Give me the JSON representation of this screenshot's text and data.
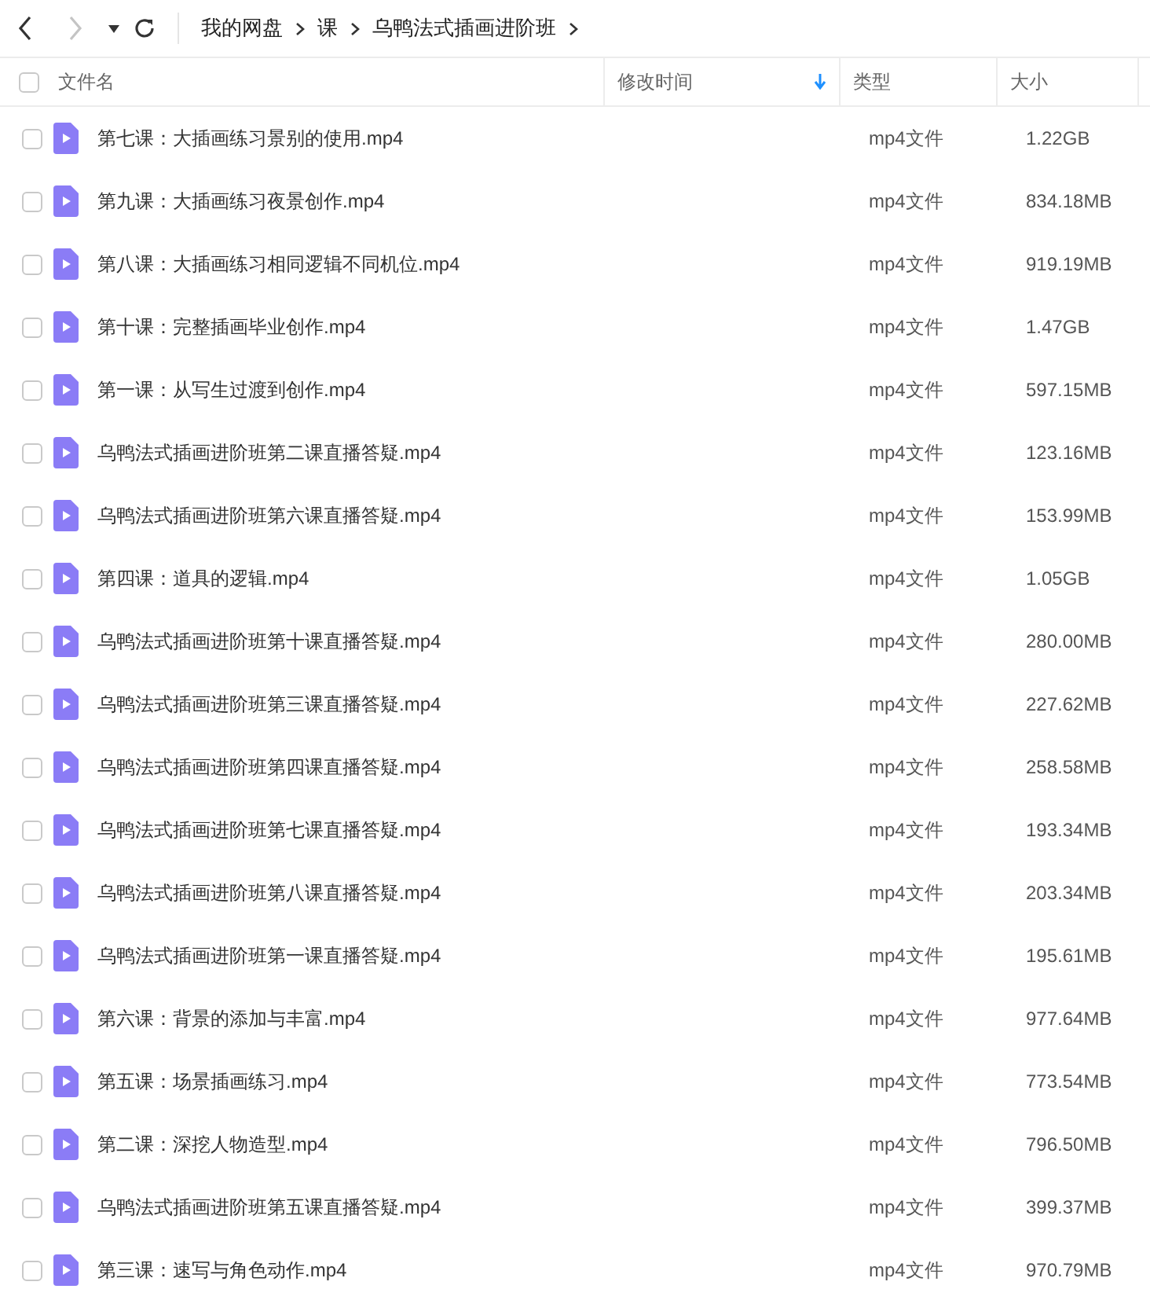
{
  "toolbar": {
    "back": {
      "disabled": false
    },
    "forward": {
      "disabled": true
    }
  },
  "breadcrumbs": [
    "我的网盘",
    "课",
    "乌鸭法式插画进阶班"
  ],
  "columns": [
    {
      "label": "文件名",
      "sorted": false
    },
    {
      "label": "修改时间",
      "sorted": true
    },
    {
      "label": "类型",
      "sorted": false
    },
    {
      "label": "大小",
      "sorted": false
    }
  ],
  "header_checkbox": {
    "checked": false
  },
  "files": [
    {
      "name": "第七课：大插画练习景别的使用.mp4",
      "type": "mp4文件",
      "size": "1.22GB",
      "checked": false
    },
    {
      "name": "第九课：大插画练习夜景创作.mp4",
      "type": "mp4文件",
      "size": "834.18MB",
      "checked": false
    },
    {
      "name": "第八课：大插画练习相同逻辑不同机位.mp4",
      "type": "mp4文件",
      "size": "919.19MB",
      "checked": false
    },
    {
      "name": "第十课：完整插画毕业创作.mp4",
      "type": "mp4文件",
      "size": "1.47GB",
      "checked": false
    },
    {
      "name": "第一课：从写生过渡到创作.mp4",
      "type": "mp4文件",
      "size": "597.15MB",
      "checked": false
    },
    {
      "name": "乌鸭法式插画进阶班第二课直播答疑.mp4",
      "type": "mp4文件",
      "size": "123.16MB",
      "checked": false
    },
    {
      "name": "乌鸭法式插画进阶班第六课直播答疑.mp4",
      "type": "mp4文件",
      "size": "153.99MB",
      "checked": false
    },
    {
      "name": "第四课：道具的逻辑.mp4",
      "type": "mp4文件",
      "size": "1.05GB",
      "checked": false
    },
    {
      "name": "乌鸭法式插画进阶班第十课直播答疑.mp4",
      "type": "mp4文件",
      "size": "280.00MB",
      "checked": false
    },
    {
      "name": "乌鸭法式插画进阶班第三课直播答疑.mp4",
      "type": "mp4文件",
      "size": "227.62MB",
      "checked": false
    },
    {
      "name": "乌鸭法式插画进阶班第四课直播答疑.mp4",
      "type": "mp4文件",
      "size": "258.58MB",
      "checked": false
    },
    {
      "name": "乌鸭法式插画进阶班第七课直播答疑.mp4",
      "type": "mp4文件",
      "size": "193.34MB",
      "checked": false
    },
    {
      "name": "乌鸭法式插画进阶班第八课直播答疑.mp4",
      "type": "mp4文件",
      "size": "203.34MB",
      "checked": false
    },
    {
      "name": "乌鸭法式插画进阶班第一课直播答疑.mp4",
      "type": "mp4文件",
      "size": "195.61MB",
      "checked": false
    },
    {
      "name": "第六课：背景的添加与丰富.mp4",
      "type": "mp4文件",
      "size": "977.64MB",
      "checked": false
    },
    {
      "name": "第五课：场景插画练习.mp4",
      "type": "mp4文件",
      "size": "773.54MB",
      "checked": false
    },
    {
      "name": "第二课：深挖人物造型.mp4",
      "type": "mp4文件",
      "size": "796.50MB",
      "checked": false
    },
    {
      "name": "乌鸭法式插画进阶班第五课直播答疑.mp4",
      "type": "mp4文件",
      "size": "399.37MB",
      "checked": false
    },
    {
      "name": "第三课：速写与角色动作.mp4",
      "type": "mp4文件",
      "size": "970.79MB",
      "checked": false
    }
  ]
}
